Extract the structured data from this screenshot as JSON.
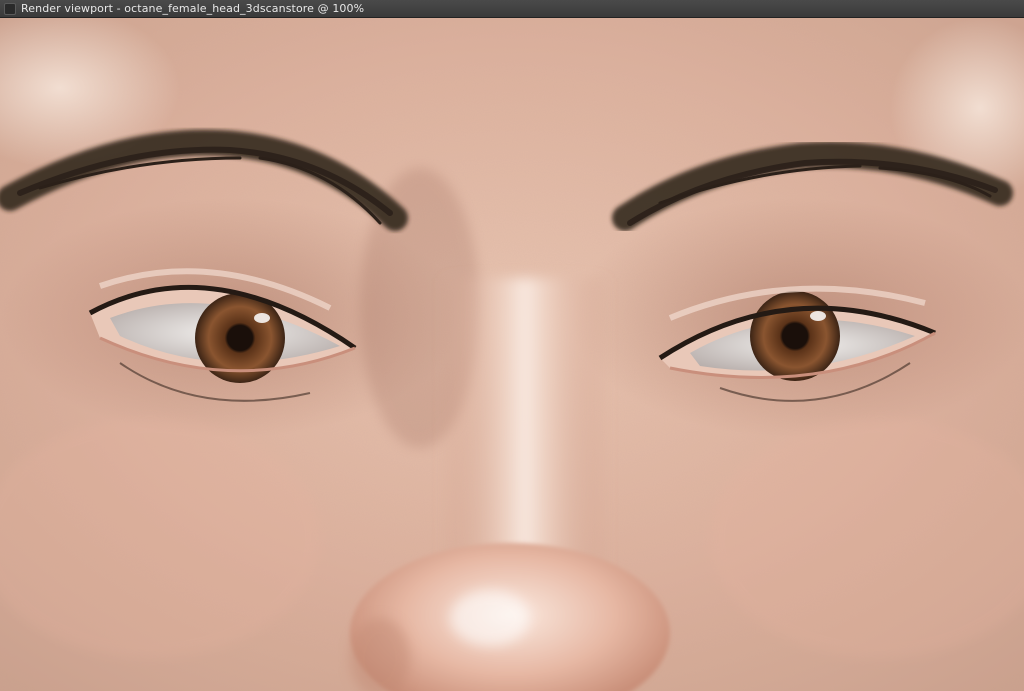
{
  "window": {
    "title": "Render viewport - octane_female_head_3dscanstore @ 100%"
  },
  "viewport": {
    "content": "rendered-face-closeup"
  },
  "colors": {
    "titlebar": "#3f3f3f",
    "title_text": "#e8e8e8",
    "skin_light": "#f0d6c6",
    "skin_mid": "#d8a893",
    "iris": "#6b3f22",
    "brow": "#2b2019"
  }
}
